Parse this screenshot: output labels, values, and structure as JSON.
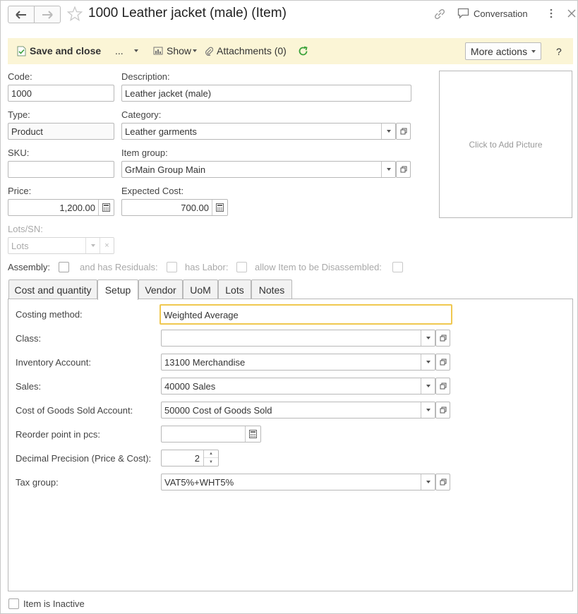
{
  "window": {
    "title": "1000 Leather jacket (male) (Item)",
    "conversation_label": "Conversation"
  },
  "toolbar": {
    "save_close": "Save and close",
    "ellipsis": "...",
    "show": "Show",
    "attachments": "Attachments (0)",
    "more_actions": "More actions",
    "help": "?"
  },
  "form": {
    "code_label": "Code:",
    "code_value": "1000",
    "description_label": "Description:",
    "description_value": "Leather jacket (male)",
    "type_label": "Type:",
    "type_value": "Product",
    "category_label": "Category:",
    "category_value": "Leather garments",
    "sku_label": "SKU:",
    "sku_value": "",
    "item_group_label": "Item group:",
    "item_group_value": "GrMain Group Main",
    "price_label": "Price:",
    "price_value": "1,200.00",
    "expected_cost_label": "Expected Cost:",
    "expected_cost_value": "700.00",
    "lots_sn_label": "Lots/SN:",
    "lots_sn_value": "Lots",
    "picture_placeholder": "Click to Add Picture",
    "assembly_label": "Assembly:",
    "residuals_label": "and has Residuals:",
    "labor_label": "has Labor:",
    "disassemble_label": "allow Item to be Disassembled:"
  },
  "tabs": [
    {
      "label": "Cost and quantity"
    },
    {
      "label": "Setup"
    },
    {
      "label": "Vendor"
    },
    {
      "label": "UoM"
    },
    {
      "label": "Lots"
    },
    {
      "label": "Notes"
    }
  ],
  "setup": {
    "costing_method_label": "Costing method:",
    "costing_method_value": "Weighted Average",
    "class_label": "Class:",
    "class_value": "",
    "inventory_account_label": "Inventory Account:",
    "inventory_account_value": "13100 Merchandise",
    "sales_label": "Sales:",
    "sales_value": "40000 Sales",
    "cogs_label": "Cost of Goods Sold Account:",
    "cogs_value": "50000 Cost of Goods Sold",
    "reorder_label": "Reorder point in pcs:",
    "reorder_value": "",
    "decimal_label": "Decimal Precision (Price & Cost):",
    "decimal_value": "2",
    "tax_group_label": "Tax group:",
    "tax_group_value": "VAT5%+WHT5%"
  },
  "footer": {
    "inactive_label": "Item is Inactive"
  },
  "colors": {
    "toolbar_bg": "#fbf5d6",
    "focus_border": "#f0c850",
    "refresh_icon": "#3aa23a"
  }
}
